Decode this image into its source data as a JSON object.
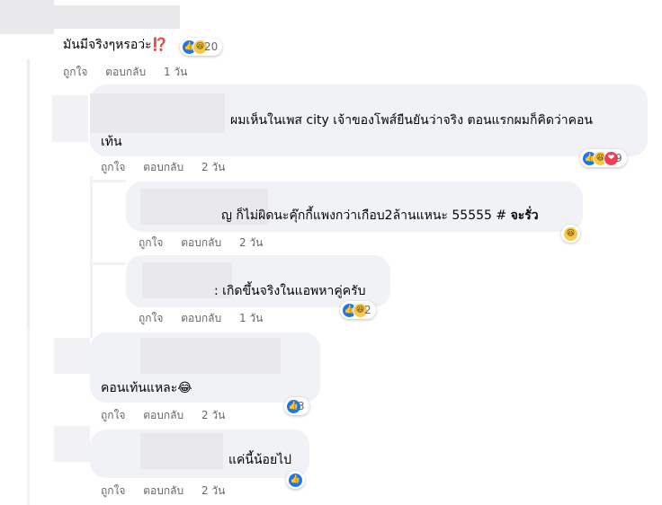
{
  "action_labels": {
    "like": "ถูกใจ",
    "reply": "ตอบกลับ"
  },
  "comments": [
    {
      "id": "c1",
      "text": "มันมีจริงๆหรอว่ะ⁉️",
      "time": "1 วัน",
      "reactions": {
        "icons": [
          "like-icon",
          "haha-icon"
        ],
        "count": "20"
      }
    },
    {
      "id": "c2",
      "text_line1": "ผมเห็นในเพส city เจ้าของโพส์ยืนยันว่าจริง ตอนแรกผมก็คิดว่าคอน",
      "text_line2": "เท้น",
      "time": "2 วัน",
      "reactions": {
        "icons": [
          "like-icon",
          "haha-icon",
          "love-icon"
        ],
        "count": "9"
      }
    },
    {
      "id": "c3",
      "text": "ญ ก็ไม่ผิดนะคุ๊กกี้แพงกว่าเกือบ2ล้านแหนะ 55555 #",
      "text_bold": "จะรั่ว",
      "time": "2 วัน",
      "reactions": {
        "icons": [
          "haha-icon"
        ],
        "count": ""
      }
    },
    {
      "id": "c4",
      "text": ": เกิดขึ้นจริงในแอพหาคู่ครับ",
      "time": "1 วัน",
      "reactions": {
        "icons": [
          "like-icon",
          "haha-icon"
        ],
        "count": "2"
      }
    },
    {
      "id": "c5",
      "text": "คอนเท้นแหละ😂",
      "time": "2 วัน",
      "reactions": {
        "icons": [
          "like-icon"
        ],
        "count": "3"
      }
    },
    {
      "id": "c6",
      "text": "แค่นี้น้อยไป",
      "time": "2 วัน",
      "reactions": {
        "icons": [
          "like-icon"
        ],
        "count": ""
      }
    }
  ],
  "colors": {
    "like": "#1877f2",
    "haha": "#f7c948",
    "love": "#f33e58",
    "bubble": "#f0f2f5",
    "meta_text": "#65676b"
  }
}
